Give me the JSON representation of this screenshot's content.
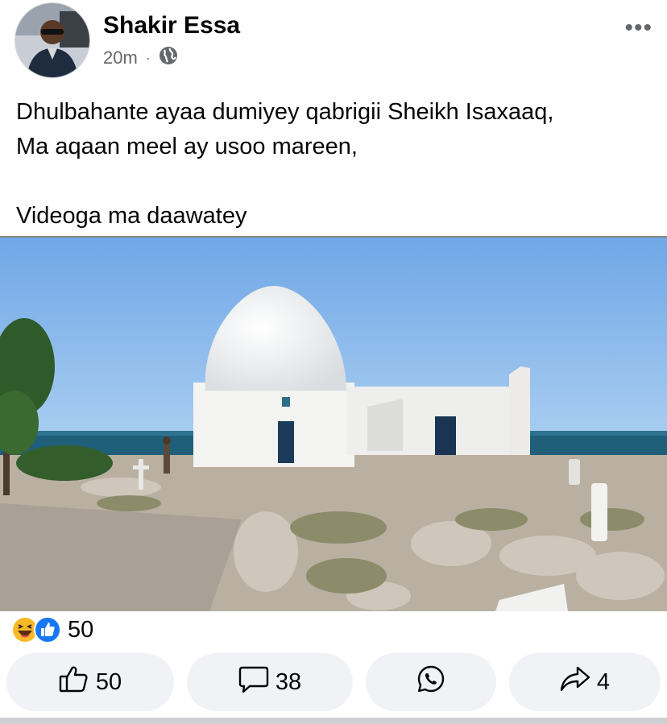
{
  "post": {
    "author": "Shakir Essa",
    "time": "20m",
    "separator": "·",
    "privacy_icon": "globe-icon",
    "more_label": "•••",
    "text_lines": [
      "Dhulbahante ayaa dumiyey qabrigii Sheikh Isaxaaq,",
      "Ma aqaan meel ay usoo mareen,",
      "Videoga ma daawatey"
    ]
  },
  "reactions": {
    "icons": [
      "haha-icon",
      "like-icon"
    ],
    "count": "50"
  },
  "actions": {
    "like_count": "50",
    "comment_count": "38",
    "share_count": "4"
  },
  "colors": {
    "like_blue": "#1877f2",
    "haha_yellow": "#f7b928",
    "meta_gray": "#65676b",
    "pill_bg": "#f0f2f5",
    "sky": "#7fb3ea"
  }
}
